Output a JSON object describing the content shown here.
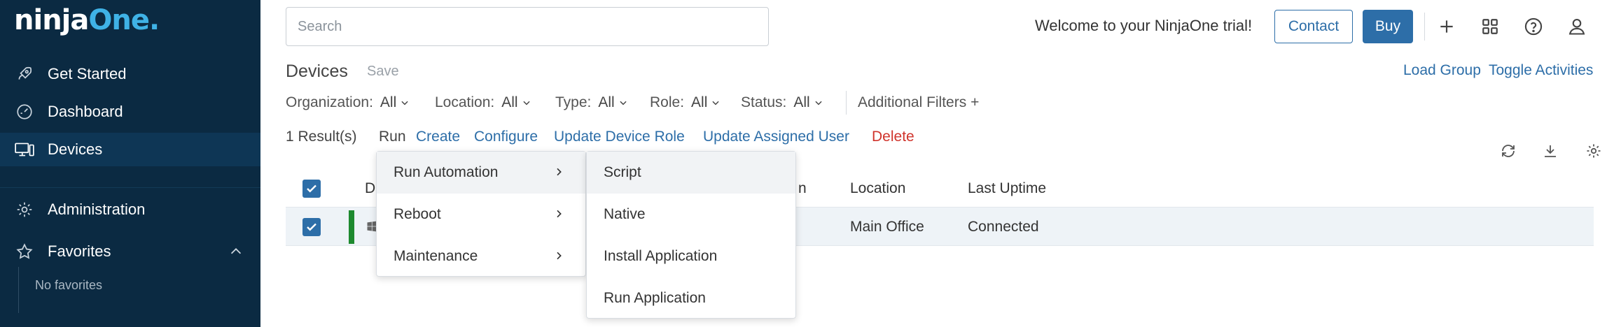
{
  "brand": {
    "part1": "ninja",
    "part2": "One",
    "dot": "."
  },
  "sidebar": {
    "items": [
      {
        "label": "Get Started",
        "icon": "rocket-icon"
      },
      {
        "label": "Dashboard",
        "icon": "gauge-icon"
      },
      {
        "label": "Devices",
        "icon": "devices-icon",
        "active": true
      },
      {
        "label": "Administration",
        "icon": "gear-icon"
      },
      {
        "label": "Favorites",
        "icon": "star-icon"
      }
    ],
    "no_favorites": "No favorites"
  },
  "topbar": {
    "search_placeholder": "Search",
    "welcome": "Welcome to your NinjaOne trial!",
    "contact": "Contact",
    "buy": "Buy",
    "icons": [
      "plus-icon",
      "apps-grid-icon",
      "help-icon",
      "user-icon"
    ]
  },
  "page": {
    "title": "Devices",
    "save": "Save",
    "load_group": "Load Group",
    "toggle_activities": "Toggle Activities"
  },
  "filters": [
    {
      "label": "Organization:",
      "value": "All"
    },
    {
      "label": "Location:",
      "value": "All"
    },
    {
      "label": "Type:",
      "value": "All"
    },
    {
      "label": "Role:",
      "value": "All"
    },
    {
      "label": "Status:",
      "value": "All"
    }
  ],
  "additional_filters": "Additional Filters +",
  "actions": {
    "results": "1 Result(s)",
    "run": "Run",
    "create": "Create",
    "configure": "Configure",
    "update_role": "Update Device Role",
    "update_user": "Update Assigned User",
    "delete": "Delete"
  },
  "table": {
    "headers": {
      "first_partial": "D",
      "col_partial": "n",
      "location": "Location",
      "last_uptime": "Last Uptime"
    },
    "row": {
      "location": "Main Office",
      "last_uptime": "Connected"
    }
  },
  "run_menu": [
    {
      "label": "Run Automation"
    },
    {
      "label": "Reboot"
    },
    {
      "label": "Maintenance"
    }
  ],
  "submenu": [
    {
      "label": "Script"
    },
    {
      "label": "Native"
    },
    {
      "label": "Install Application"
    },
    {
      "label": "Run Application"
    }
  ],
  "colors": {
    "sidebar_bg": "#0b2a42",
    "accent": "#2d6ea8",
    "brand_one": "#3fb2e6",
    "delete": "#d0342c",
    "status_green": "#1e8a2f"
  }
}
